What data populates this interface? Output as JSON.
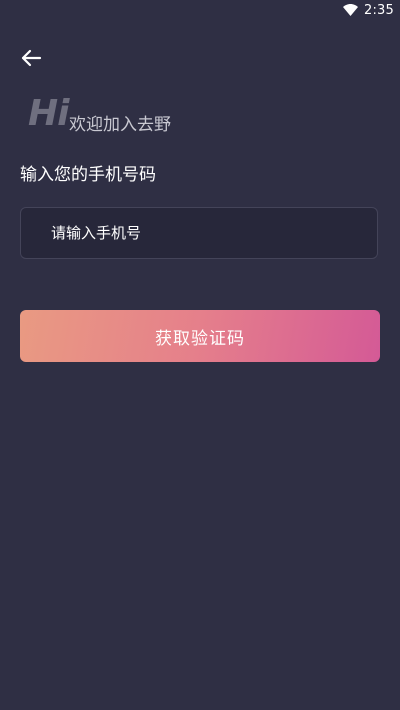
{
  "status_bar": {
    "time": "2:35",
    "wifi_icon": "wifi-icon"
  },
  "header": {
    "back_icon": "arrow-left-icon"
  },
  "welcome": {
    "logo_text": "Hi",
    "text": "欢迎加入去野"
  },
  "form": {
    "phone_label": "输入您的手机号码",
    "phone_placeholder": "请输入手机号",
    "phone_value": "",
    "submit_label": "获取验证码"
  },
  "colors": {
    "background": "#2f2f44",
    "input_background": "#27273a",
    "input_border": "#444459",
    "button_gradient_start": "#e99a82",
    "button_gradient_end": "#d45a96"
  }
}
